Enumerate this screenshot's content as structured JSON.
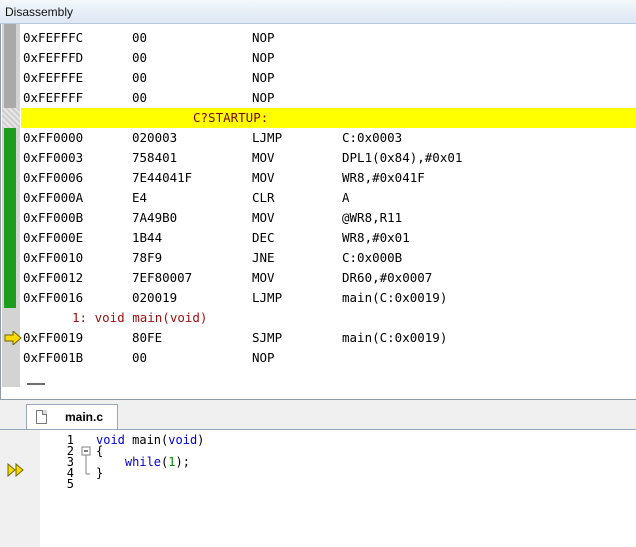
{
  "window": {
    "title": "Disassembly"
  },
  "disassembly": {
    "rows": [
      {
        "kind": "code",
        "addr": "0xFEFFFC",
        "bytes": "00",
        "mnem": "NOP",
        "oper": ""
      },
      {
        "kind": "code",
        "addr": "0xFEFFFD",
        "bytes": "00",
        "mnem": "NOP",
        "oper": ""
      },
      {
        "kind": "code",
        "addr": "0xFEFFFE",
        "bytes": "00",
        "mnem": "NOP",
        "oper": ""
      },
      {
        "kind": "code",
        "addr": "0xFEFFFF",
        "bytes": "00",
        "mnem": "NOP",
        "oper": ""
      },
      {
        "kind": "label",
        "text": "C?STARTUP:"
      },
      {
        "kind": "code",
        "addr": "0xFF0000",
        "bytes": "020003",
        "mnem": "LJMP",
        "oper": "C:0x0003"
      },
      {
        "kind": "code",
        "addr": "0xFF0003",
        "bytes": "758401",
        "mnem": "MOV",
        "oper": "DPL1(0x84),#0x01"
      },
      {
        "kind": "code",
        "addr": "0xFF0006",
        "bytes": "7E44041F",
        "mnem": "MOV",
        "oper": "WR8,#0x041F"
      },
      {
        "kind": "code",
        "addr": "0xFF000A",
        "bytes": "E4",
        "mnem": "CLR",
        "oper": "A"
      },
      {
        "kind": "code",
        "addr": "0xFF000B",
        "bytes": "7A49B0",
        "mnem": "MOV",
        "oper": "@WR8,R11"
      },
      {
        "kind": "code",
        "addr": "0xFF000E",
        "bytes": "1B44",
        "mnem": "DEC",
        "oper": "WR8,#0x01"
      },
      {
        "kind": "code",
        "addr": "0xFF0010",
        "bytes": "78F9",
        "mnem": "JNE",
        "oper": "C:0x000B"
      },
      {
        "kind": "code",
        "addr": "0xFF0012",
        "bytes": "7EF80007",
        "mnem": "MOV",
        "oper": "DR60,#0x0007"
      },
      {
        "kind": "code",
        "addr": "0xFF0016",
        "bytes": "020019",
        "mnem": "LJMP",
        "oper": "main(C:0x0019)"
      },
      {
        "kind": "source",
        "text": "1: void main(void)"
      },
      {
        "kind": "current",
        "addr": "0xFF0019",
        "bytes": "80FE",
        "mnem": "SJMP",
        "oper": "main(C:0x0019)"
      },
      {
        "kind": "code",
        "addr": "0xFF001B",
        "bytes": "00",
        "mnem": "NOP",
        "oper": ""
      }
    ]
  },
  "editor": {
    "tab_label": "main.c",
    "lines": [
      {
        "num": "1",
        "fold": "",
        "parts": [
          {
            "t": "void",
            "c": "kw"
          },
          {
            "t": " main(",
            "c": ""
          },
          {
            "t": "void",
            "c": "kw"
          },
          {
            "t": ")",
            "c": ""
          }
        ]
      },
      {
        "num": "2",
        "fold": "open",
        "parts": [
          {
            "t": "{",
            "c": ""
          }
        ]
      },
      {
        "num": "3",
        "fold": "mid",
        "parts": [
          {
            "t": "    ",
            "c": ""
          },
          {
            "t": "while",
            "c": "kw"
          },
          {
            "t": "(",
            "c": ""
          },
          {
            "t": "1",
            "c": "numlit"
          },
          {
            "t": ");",
            "c": ""
          }
        ]
      },
      {
        "num": "4",
        "fold": "end",
        "parts": [
          {
            "t": "}",
            "c": ""
          }
        ]
      },
      {
        "num": "5",
        "fold": "",
        "parts": []
      }
    ]
  },
  "colors": {
    "current_line_arrow": "#ffd800",
    "startup_highlight": "#ffff00",
    "executed_marker": "#1d9d1d"
  }
}
